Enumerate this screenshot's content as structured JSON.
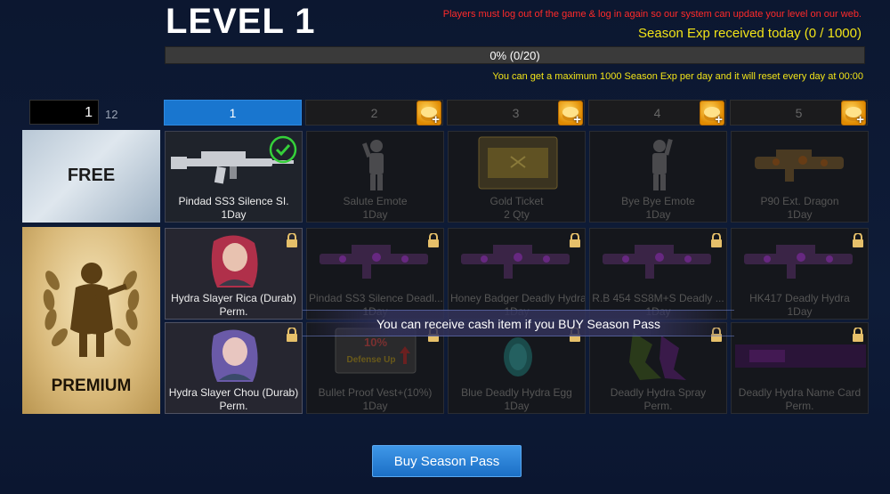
{
  "header": {
    "level_title": "LEVEL 1",
    "notice": "Players must log out of the game & log in again so our system can update your level on our web.",
    "season_exp": "Season Exp received today (0 / 1000)",
    "progress_text": "0% (0/20)",
    "progress_fraction": 0,
    "max_note": "You can get a maximum 1000 Season Exp per day and it will reset every day at 00:00"
  },
  "pager": {
    "current": "1",
    "total": "12"
  },
  "tabs": [
    {
      "label": "1",
      "active": true,
      "coin": false
    },
    {
      "label": "2",
      "active": false,
      "coin": true
    },
    {
      "label": "3",
      "active": false,
      "coin": true
    },
    {
      "label": "4",
      "active": false,
      "coin": true
    },
    {
      "label": "5",
      "active": false,
      "coin": true
    }
  ],
  "side": {
    "free_label": "FREE",
    "premium_label": "PREMIUM"
  },
  "free_row": [
    {
      "name": "Pindad SS3 Silence SI.",
      "qty": "1Day",
      "claimed": true,
      "icon": "rifle-icon"
    },
    {
      "name": "Salute Emote",
      "qty": "1Day",
      "claimed": false,
      "icon": "salute-emote-icon"
    },
    {
      "name": "Gold Ticket",
      "qty": "2 Qty",
      "claimed": false,
      "icon": "gold-ticket-icon"
    },
    {
      "name": "Bye Bye Emote",
      "qty": "1Day",
      "claimed": false,
      "icon": "bye-emote-icon"
    },
    {
      "name": "P90 Ext. Dragon",
      "qty": "1Day",
      "claimed": false,
      "icon": "smg-icon"
    }
  ],
  "premium_row1": [
    {
      "name": "Hydra Slayer Rica (Durab)",
      "qty": "Perm.",
      "icon": "character-rica-icon"
    },
    {
      "name": "Pindad SS3 Silence Deadl...",
      "qty": "1Day",
      "icon": "rifle-icon"
    },
    {
      "name": "Honey Badger Deadly Hydra",
      "qty": "1Day",
      "icon": "rifle-icon"
    },
    {
      "name": "R.B 454 SS8M+S Deadly ...",
      "qty": "1Day",
      "icon": "rifle-icon"
    },
    {
      "name": "HK417 Deadly Hydra",
      "qty": "1Day",
      "icon": "rifle-icon"
    }
  ],
  "premium_row2": [
    {
      "name": "Hydra Slayer Chou (Durab)",
      "qty": "Perm.",
      "icon": "character-chou-icon"
    },
    {
      "name": "Bullet Proof Vest+(10%)",
      "qty": "1Day",
      "icon": "defense-up-icon",
      "badge_pct": "10%",
      "badge_text": "Defense Up"
    },
    {
      "name": "Blue Deadly Hydra Egg",
      "qty": "1Day",
      "icon": "egg-icon"
    },
    {
      "name": "Deadly Hydra Spray",
      "qty": "Perm.",
      "icon": "spray-icon"
    },
    {
      "name": "Deadly Hydra Name Card",
      "qty": "Perm.",
      "icon": "name-card-icon"
    }
  ],
  "banner_text": "You can receive cash item if you BUY Season Pass",
  "buy_button": "Buy Season Pass",
  "colors": {
    "accent_blue": "#1976cf",
    "notice_red": "#ff2a2a",
    "exp_yellow": "#f2e418",
    "check_green": "#35d03a"
  }
}
